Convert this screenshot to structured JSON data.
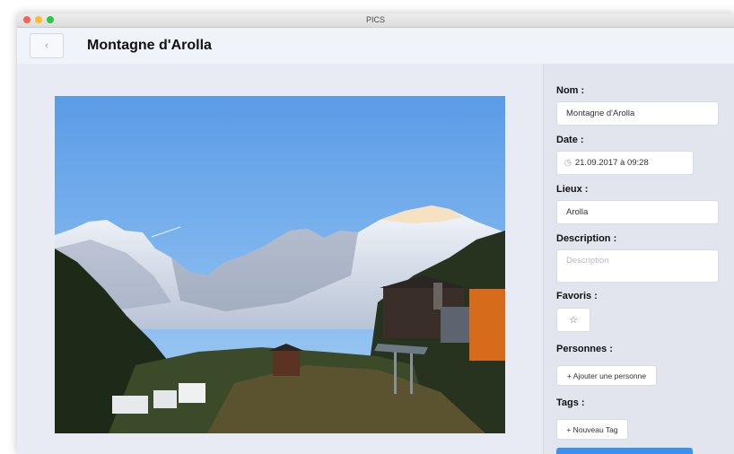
{
  "window": {
    "title": "PICS"
  },
  "header": {
    "back_icon": "‹",
    "title": "Montagne d'Arolla"
  },
  "form": {
    "name_label": "Nom :",
    "name_value": "Montagne d'Arolla",
    "date_label": "Date :",
    "date_icon": "◷",
    "date_value": "21.09.2017 à 09:28",
    "location_label": "Lieux :",
    "location_value": "Arolla",
    "description_label": "Description :",
    "description_placeholder": "Description",
    "favorites_label": "Favoris :",
    "favorite_icon": "☆",
    "people_label": "Personnes :",
    "add_person_label": "+ Ajouter une personne",
    "tags_label": "Tags :",
    "new_tag_label": "+ Nouveau Tag"
  },
  "colors": {
    "accent": "#3a91f1",
    "sky": "#6aa8ea",
    "header_bg": "#f1f3fb"
  }
}
